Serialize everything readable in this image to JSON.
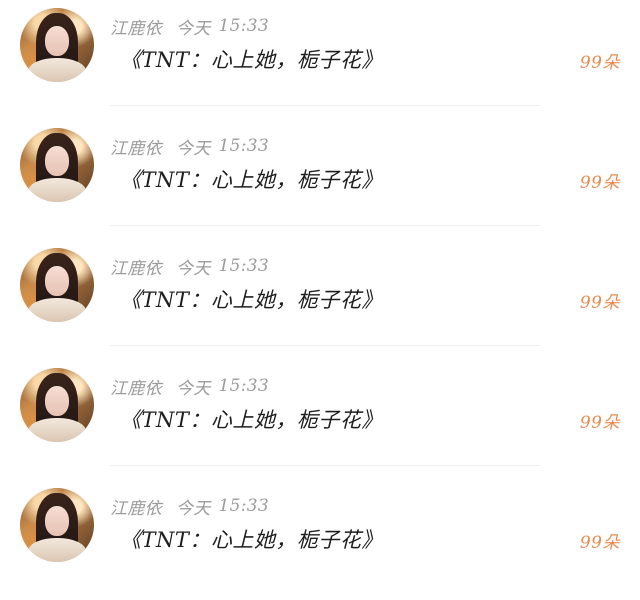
{
  "feed": {
    "items": [
      {
        "name": "江鹿依",
        "day": "今天",
        "time": "15:33",
        "message": "《TNT：心上她，栀子花》",
        "amount": "99朵"
      },
      {
        "name": "江鹿依",
        "day": "今天",
        "time": "15:33",
        "message": "《TNT：心上她，栀子花》",
        "amount": "99朵"
      },
      {
        "name": "江鹿依",
        "day": "今天",
        "time": "15:33",
        "message": "《TNT：心上她，栀子花》",
        "amount": "99朵"
      },
      {
        "name": "江鹿依",
        "day": "今天",
        "time": "15:33",
        "message": "《TNT：心上她，栀子花》",
        "amount": "99朵"
      },
      {
        "name": "江鹿依",
        "day": "今天",
        "time": "15:33",
        "message": "《TNT：心上她，栀子花》",
        "amount": "99朵"
      }
    ]
  }
}
